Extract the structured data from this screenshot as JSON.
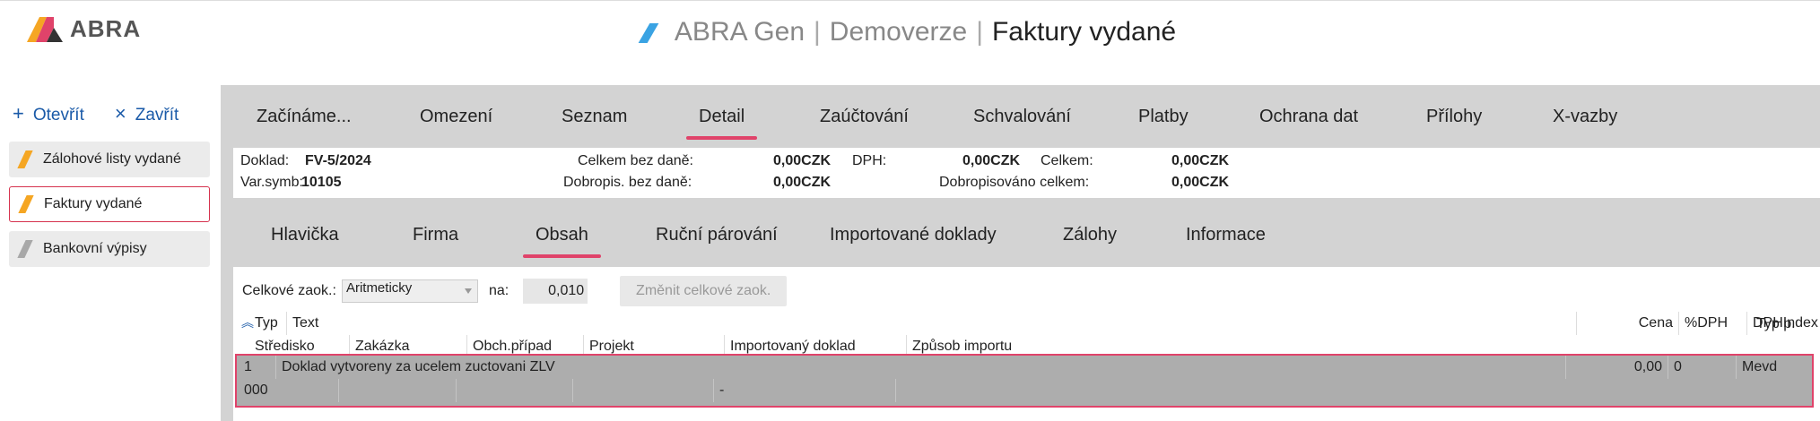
{
  "app": {
    "logo_text": "ABRA",
    "title_part1": "ABRA Gen",
    "title_part2": "Demoverze",
    "title_part3": "Faktury vydané",
    "colors": {
      "accent": "#e0436a",
      "link": "#1a5aa8",
      "doc_orange": "#f5a623",
      "doc_gray": "#a8a8a8",
      "title_blue": "#3aa3e3"
    }
  },
  "left": {
    "open_label": "Otevřít",
    "close_label": "Zavřít",
    "items": [
      {
        "label": "Zálohové listy vydané",
        "icon": "document-orange-icon"
      },
      {
        "label": "Faktury vydané",
        "icon": "document-orange-icon"
      },
      {
        "label": "Bankovní výpisy",
        "icon": "document-gray-icon"
      }
    ]
  },
  "tabs": [
    "Začínáme...",
    "Omezení",
    "Seznam",
    "Detail",
    "Zaúčtování",
    "Schvalování",
    "Platby",
    "Ochrana dat",
    "Přílohy",
    "X-vazby"
  ],
  "info": {
    "doklad_label": "Doklad:",
    "doklad_value": "FV-5/2024",
    "varsymb_label": "Var.symb:",
    "varsymb_value": "10105",
    "celkem_bez_dane_label": "Celkem bez daně:",
    "celkem_bez_dane_value": "0,00CZK",
    "dph_label": "DPH:",
    "dph_value": "0,00CZK",
    "celkem_label": "Celkem:",
    "celkem_value": "0,00CZK",
    "dobropis_bez_dane_label": "Dobropis. bez daně:",
    "dobropis_bez_dane_value": "0,00CZK",
    "dobropisovano_label": "Dobropisováno celkem:",
    "dobropisovano_value": "0,00CZK"
  },
  "subtabs": [
    "Hlavička",
    "Firma",
    "Obsah",
    "Ruční párování",
    "Importované doklady",
    "Zálohy",
    "Informace"
  ],
  "rounding": {
    "label": "Celkové zaok.:",
    "select_value": "Aritmeticky",
    "na_label": "na:",
    "na_value": "0,010",
    "button_label": "Změnit celkové zaok."
  },
  "grid": {
    "header1": {
      "typ": "Typ",
      "text": "Text",
      "cena": "Cena",
      "dph": "%DPH",
      "dphindex": "DPHIndex",
      "typp": "Typ p."
    },
    "header2": {
      "stredisko": "Středisko",
      "zakazka": "Zakázka",
      "obchpripad": "Obch.případ",
      "projekt": "Projekt",
      "importovany": "Importovaný doklad",
      "zpusob": "Způsob importu"
    },
    "row1": {
      "typ": "1",
      "text": "Doklad vytvoreny za ucelem zuctovani ZLV",
      "cena": "0,00",
      "dph": "0",
      "dphindex": "Mevd"
    },
    "row2": {
      "stredisko": "000",
      "importovany": "-"
    }
  }
}
